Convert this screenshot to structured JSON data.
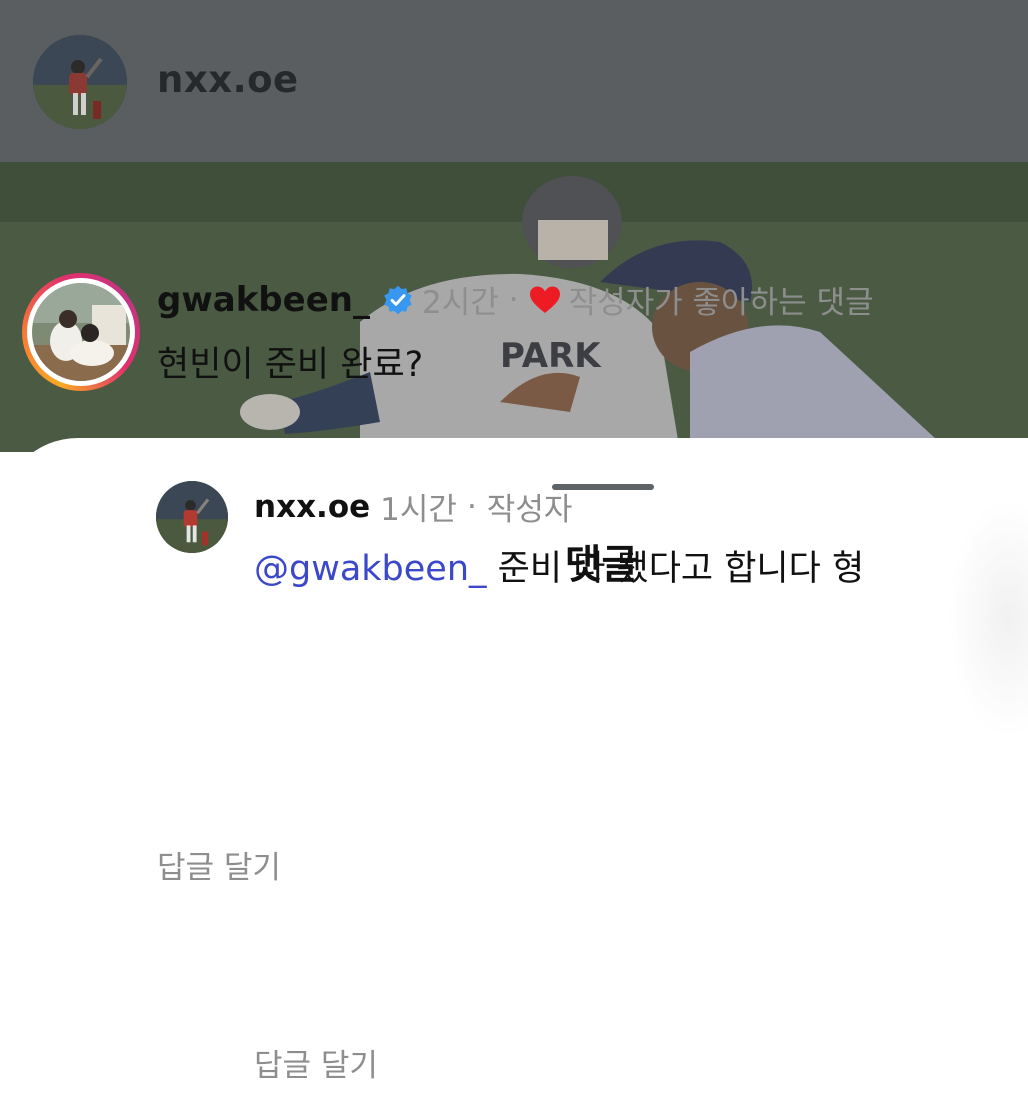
{
  "post": {
    "username": "nxx.oe",
    "photo_jersey_text": "PARK"
  },
  "sheet": {
    "title": "댓글"
  },
  "comment": {
    "username": "gwakbeen_",
    "verified_icon": "verified-badge-icon",
    "time": "2시간",
    "separator": "·",
    "liked_by_author_icon": "heart-icon",
    "liked_by_author_text": "작성자가 좋아하는 댓글",
    "text": "현빈이 준비 완료?",
    "reply_label": "답글 달기"
  },
  "reply": {
    "username": "nxx.oe",
    "time": "1시간",
    "separator": "·",
    "author_label": "작성자",
    "mention": "@gwakbeen_",
    "text": " 준비 다 됐다고 합니다 형",
    "reply_label": "답글 달기"
  },
  "colors": {
    "mention": "#3b48c9",
    "heart": "#ed1c24",
    "verified": "#3897f0",
    "secondary_text": "#8e8e8e"
  }
}
